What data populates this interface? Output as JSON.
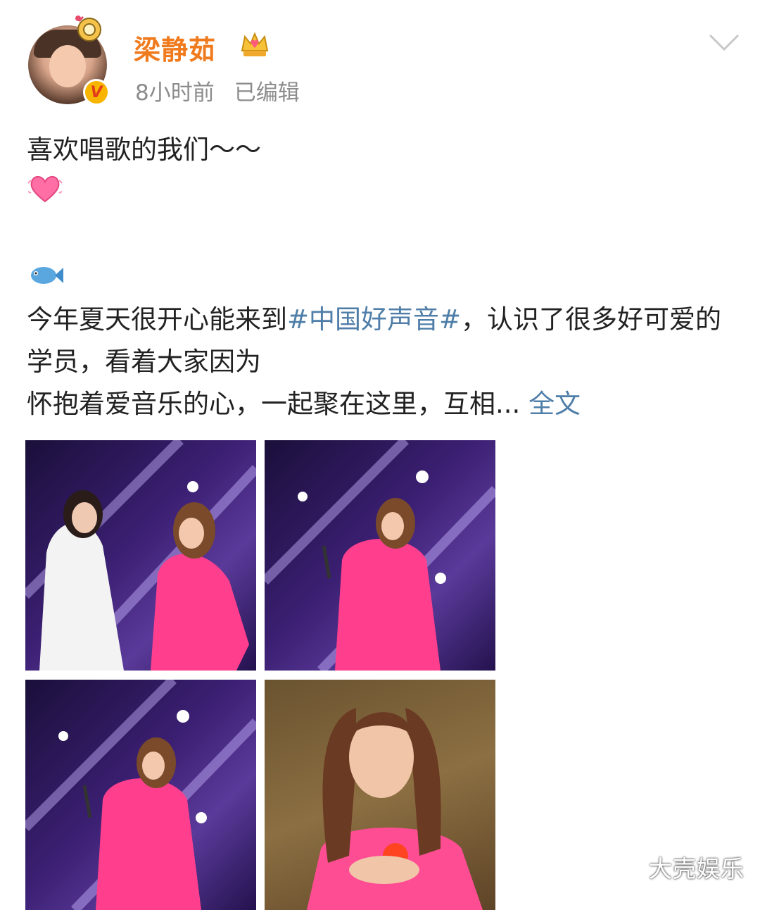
{
  "post": {
    "author_name": "梁静茹",
    "time": "8小时前",
    "edited_label": "已编辑",
    "line1": "喜欢唱歌的我们～～",
    "para_text_a": "今年夏天很开心能来到",
    "hashtag": "#中国好声音#",
    "para_text_b": "，认识了很多好可爱的学员，看着大家因为",
    "para_text_c": "怀抱着爱音乐的心，一起聚在这里，互相...",
    "more_label": "全文"
  },
  "icons": {
    "verified": "verified-v-badge-icon",
    "crown": "crown-icon",
    "menu": "chevron-down-icon",
    "heart": "beating-heart-emoji-icon",
    "fish": "fish-emoji-icon"
  },
  "colors": {
    "name": "#f07b1e",
    "link": "#4f7ea8",
    "meta": "#8c8c8c",
    "text": "#222222"
  },
  "photos": [
    {
      "desc": "two-singers-holding-hands-on-stage-photo"
    },
    {
      "desc": "singer-in-pink-with-microphone-photo"
    },
    {
      "desc": "singer-in-pink-with-microphone-photo-2"
    },
    {
      "desc": "singer-in-pink-portrait-photo"
    }
  ],
  "watermark": "大壳娱乐"
}
